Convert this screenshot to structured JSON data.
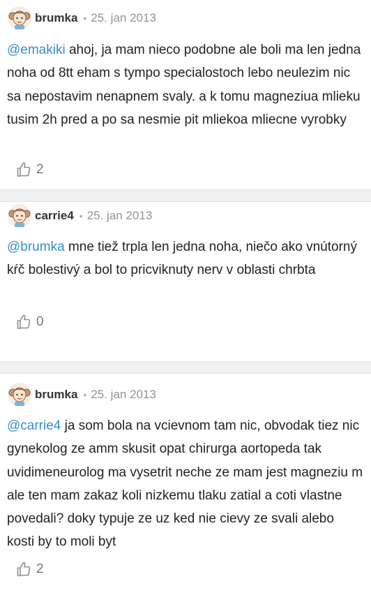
{
  "comments": [
    {
      "author": "brumka",
      "separator": "•",
      "date": "25. jan 2013",
      "mention": "@emakiki",
      "text": " ahoj, ja mam nieco podobne ale boli ma len jedna noha od 8tt eham s tympo specialostoch lebo neulezim nic sa nepostavim nenapnem svaly. a k tomu magneziua mlieku tusim 2h pred a po sa nesmie pit mliekoa mliecne vyrobky",
      "likes": "2"
    },
    {
      "author": "carrie4",
      "separator": "•",
      "date": "25. jan 2013",
      "mention": "@brumka",
      "text": " mne tiež trpla len jedna noha, niečo ako vnútorný kŕč bolestivý a bol to pricviknuty nerv v oblasti chrbta",
      "likes": "0"
    },
    {
      "author": "brumka",
      "separator": "•",
      "date": "25. jan 2013",
      "mention": "@carrie4",
      "text": " ja som bola na vcievnom tam nic, obvodak tiez nic gynekolog ze amm skusit opat chirurga aortopeda tak uvidimeneurolog ma vysetrit neche ze mam jest magneziu m ale ten mam zakaz koli nizkemu tlaku zatial a coti vlastne povedali? doky typuje ze uz ked nie cievy ze svali alebo kosti by to moli byt",
      "likes": "2"
    }
  ],
  "colors": {
    "mention": "#3a8fc9",
    "meta_text": "#8e9398",
    "separator_band": "#eef0f2"
  },
  "icons": {
    "avatar": "cartoon-girl-avatar",
    "like": "thumbs-up-outline-icon"
  }
}
